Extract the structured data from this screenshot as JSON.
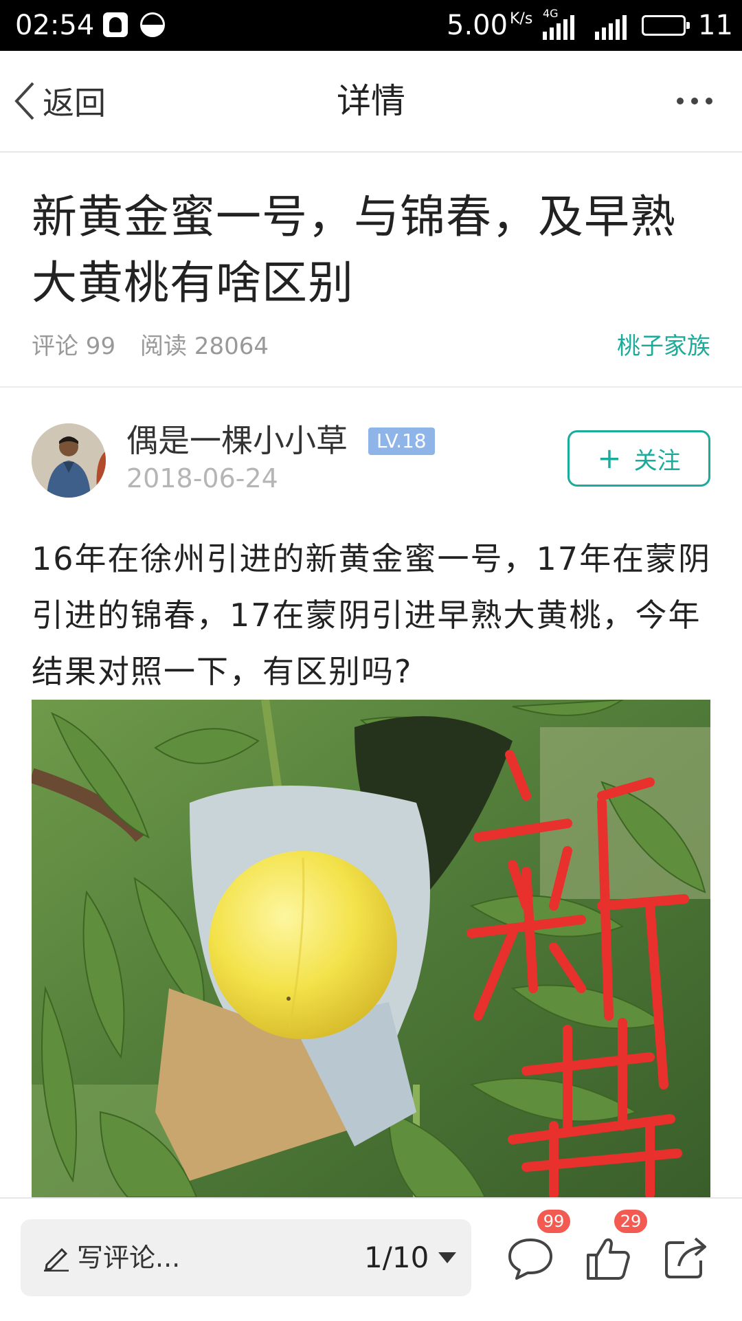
{
  "status_bar": {
    "time": "02:54",
    "network_speed": "5.00",
    "speed_unit": "K/s",
    "network_type": "4G",
    "battery_level": "11"
  },
  "nav": {
    "back_label": "返回",
    "title": "详情"
  },
  "article": {
    "title": "新黄金蜜一号，与锦春，及早熟大黄桃有啥区别",
    "comments_meta": "评论 99",
    "reads_meta": "阅读 28064",
    "channel": "桃子家族",
    "author": {
      "name": "偶是一棵小小草",
      "level": "LV.18",
      "date": "2018-06-24"
    },
    "follow_label": "关注",
    "body": "16年在徐州引进的新黄金蜜一号，17年在蒙阴引进的锦春，17在蒙阴引进早熟大黄桃，今年结果对照一下，有区别吗?",
    "photo_overlay_text": "新黄"
  },
  "bottom_bar": {
    "comment_placeholder": "写评论...",
    "page_indicator": "1/10",
    "comment_count": "99",
    "like_count": "29"
  },
  "colors": {
    "accent": "#1aab9b",
    "badge_red": "#f25a52",
    "level_badge": "#8fb4e8"
  }
}
